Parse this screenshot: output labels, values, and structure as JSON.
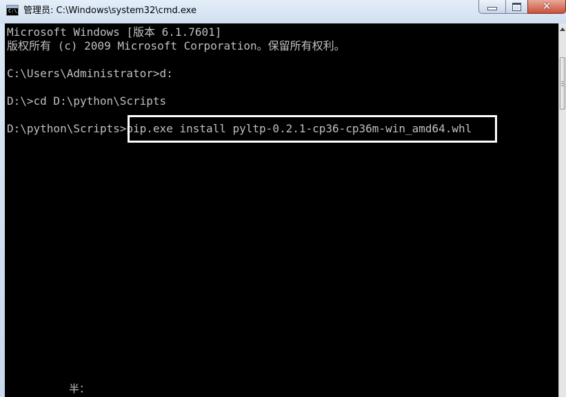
{
  "window": {
    "title": "管理员: C:\\Windows\\system32\\cmd.exe",
    "icon_text": "C:\\.",
    "close_glyph": "✕"
  },
  "console": {
    "lines": [
      "Microsoft Windows [版本 6.1.7601]",
      "版权所有 (c) 2009 Microsoft Corporation。保留所有权利。",
      "",
      "C:\\Users\\Administrator>d:",
      "",
      "D:\\>cd D:\\python\\Scripts",
      "",
      "D:\\python\\Scripts>pip.exe install pyltp-0.2.1-cp36-cp36m-win_amd64.whl"
    ],
    "ime_status": "半："
  }
}
